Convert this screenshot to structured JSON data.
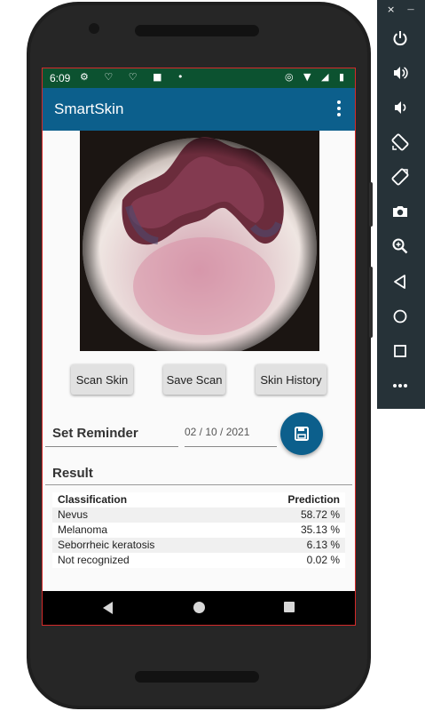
{
  "window_controls": {
    "close": "×",
    "minimize": "—"
  },
  "status_bar": {
    "time": "6:09",
    "left_icons": "⚙ ♡ ♡ ■ •",
    "right_icons": "◎ ▼ ◢ ▮"
  },
  "app_bar": {
    "title": "SmartSkin",
    "menu_icon": "overflow-menu-icon"
  },
  "buttons": {
    "scan": "Scan Skin",
    "save": "Save Scan",
    "history": "Skin History"
  },
  "reminder": {
    "label": "Set Reminder",
    "date": "02 / 10 / 2021"
  },
  "result": {
    "title": "Result",
    "headers": {
      "classification": "Classification",
      "prediction": "Prediction"
    },
    "rows": [
      {
        "label": "Nevus",
        "value": "58.72 %"
      },
      {
        "label": "Melanoma",
        "value": "35.13 %"
      },
      {
        "label": "Seborrheic keratosis",
        "value": "6.13 %"
      },
      {
        "label": "Not recognized",
        "value": "0.02 %"
      }
    ]
  },
  "colors": {
    "app_bar": "#0c5f8c",
    "status_bar": "#0c5230",
    "fab": "#0c5f8c",
    "emulator_toolbar": "#263238"
  },
  "emulator_toolbar": [
    "power-icon",
    "volume-up-icon",
    "volume-down-icon",
    "rotate-left-icon",
    "rotate-right-icon",
    "camera-icon",
    "zoom-icon",
    "back-icon",
    "home-icon",
    "overview-icon",
    "more-icon"
  ]
}
